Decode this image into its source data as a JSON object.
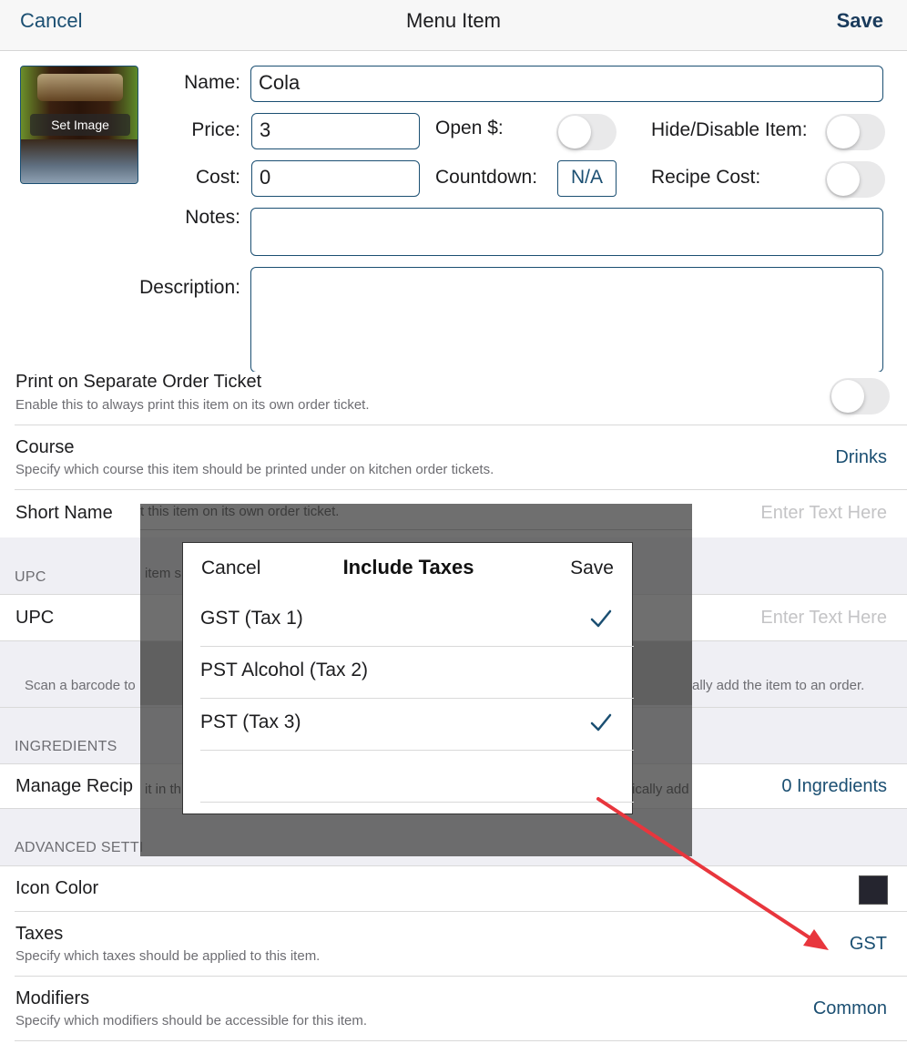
{
  "nav": {
    "cancel": "Cancel",
    "title": "Menu Item",
    "save": "Save"
  },
  "image": {
    "set_image": "Set Image"
  },
  "form": {
    "name_label": "Name:",
    "name_value": "Cola",
    "price_label": "Price:",
    "price_value": "3",
    "open_label": "Open $:",
    "hide_label": "Hide/Disable Item:",
    "cost_label": "Cost:",
    "cost_value": "0",
    "countdown_label": "Countdown:",
    "countdown_value": "N/A",
    "recipe_label": "Recipe Cost:",
    "notes_label": "Notes:",
    "notes_value": "",
    "description_label": "Description:",
    "description_value": ""
  },
  "toggles": {
    "open_price": false,
    "hide_disable": false,
    "recipe_cost": false,
    "separate_ticket": false
  },
  "rows": {
    "separate_ticket_title": "Print on Separate Order Ticket",
    "separate_ticket_sub": "Enable this to always print this item on its own order ticket.",
    "course_title": "Course",
    "course_sub": "Specify which course this item should be printed under on kitchen order tickets.",
    "course_value": "Drinks",
    "short_name_title": "Short Name",
    "short_name_placeholder": "Enter Text Here",
    "upc_section": "UPC",
    "upc_title": "UPC",
    "upc_placeholder": "Enter Text Here",
    "upc_help_left": "Scan a barcode to",
    "upc_help_right": "ally add the item to an order.",
    "ingredients_section": "INGREDIENTS",
    "manage_recipe_title": "Manage Recip",
    "manage_recipe_value": "0 Ingredients",
    "advanced_section": "ADVANCED SETTI",
    "icon_color_title": "Icon Color",
    "taxes_title": "Taxes",
    "taxes_sub": "Specify which taxes should be applied to this item.",
    "taxes_value": "GST",
    "modifiers_title": "Modifiers",
    "modifiers_sub": "Specify which modifiers should be accessible for this item.",
    "modifiers_value": "Common"
  },
  "ghost_text": {
    "line1": "t this item on its own order ticket.",
    "line2": "item s",
    "line3": "it in th",
    "line4": "ically add"
  },
  "modal": {
    "cancel": "Cancel",
    "title": "Include Taxes",
    "save": "Save",
    "taxes": [
      {
        "label": "GST (Tax 1)",
        "checked": true
      },
      {
        "label": "PST Alcohol (Tax 2)",
        "checked": false
      },
      {
        "label": "PST (Tax 3)",
        "checked": true
      },
      {
        "label": "",
        "checked": false
      }
    ]
  },
  "colors": {
    "accent": "#1b4f72",
    "icon_color_swatch": "#25252f",
    "annotation_arrow": "#e8363d"
  },
  "icons": {
    "checkmark": "checkmark-icon",
    "toggle": "toggle-switch"
  }
}
